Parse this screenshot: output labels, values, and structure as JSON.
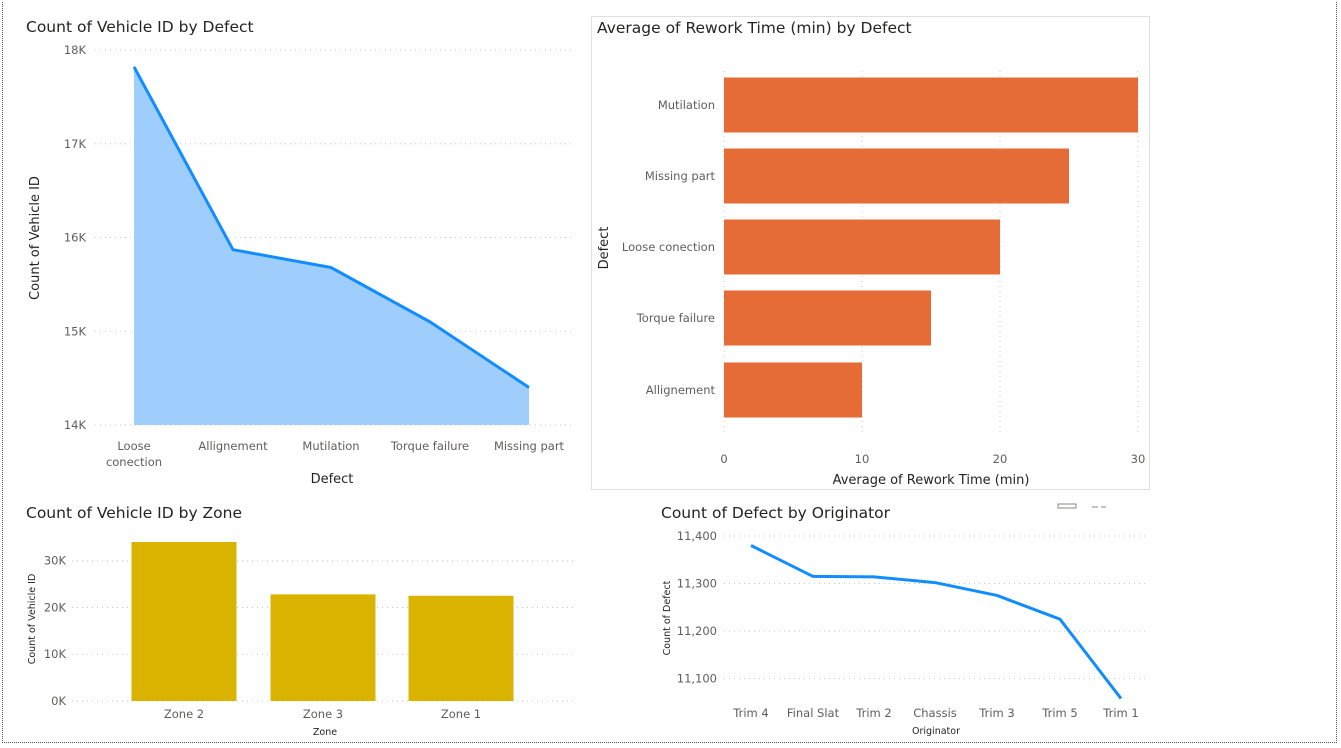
{
  "colors": {
    "line_blue": "#118DFF",
    "area_fill": "#9FCEFC",
    "bar_orange": "#E66C37",
    "bar_gold": "#D9B300"
  },
  "visuals": {
    "v1": {
      "title": "Count of Vehicle ID by Defect"
    },
    "v2": {
      "title": "Average of Rework Time (min) by Defect"
    },
    "v3": {
      "title": "Count of Vehicle ID by Zone"
    },
    "v4": {
      "title": "Count of Defect by Originator"
    }
  },
  "chart_data": [
    {
      "type": "area",
      "title": "Count of Vehicle ID by Defect",
      "xlabel": "Defect",
      "ylabel": "Count of Vehicle ID",
      "categories": [
        "Loose conection",
        "Allignement",
        "Mutilation",
        "Torque failure",
        "Missing part"
      ],
      "values": [
        17820,
        15870,
        15680,
        15100,
        14400
      ],
      "ylim": [
        14000,
        18000
      ],
      "yticks": [
        14000,
        15000,
        16000,
        17000,
        18000
      ],
      "ytick_labels": [
        "14K",
        "15K",
        "16K",
        "17K",
        "18K"
      ],
      "grid": true
    },
    {
      "type": "bar",
      "orientation": "horizontal",
      "title": "Average of Rework Time (min) by Defect",
      "xlabel": "Average of Rework Time (min)",
      "ylabel": "Defect",
      "categories": [
        "Mutilation",
        "Missing part",
        "Loose conection",
        "Torque failure",
        "Allignement"
      ],
      "values": [
        30,
        25,
        20,
        15,
        10
      ],
      "xlim": [
        0,
        30
      ],
      "xticks": [
        0,
        10,
        20,
        30
      ],
      "xtick_labels": [
        "0",
        "10",
        "20",
        "30"
      ],
      "grid": true
    },
    {
      "type": "bar",
      "title": "Count of Vehicle ID by Zone",
      "xlabel": "Zone",
      "ylabel": "Count of Vehicle ID",
      "categories": [
        "Zone 2",
        "Zone 3",
        "Zone 1"
      ],
      "values": [
        34000,
        22800,
        22500
      ],
      "ylim": [
        0,
        34000
      ],
      "yticks": [
        0,
        10000,
        20000,
        30000
      ],
      "ytick_labels": [
        "0K",
        "10K",
        "20K",
        "30K"
      ],
      "grid": true
    },
    {
      "type": "line",
      "title": "Count of Defect by Originator",
      "xlabel": "Originator",
      "ylabel": "Count of Defect",
      "categories": [
        "Trim 4",
        "Final Slat",
        "Trim 2",
        "Chassis",
        "Trim 3",
        "Trim 5",
        "Trim 1"
      ],
      "values": [
        11380,
        11315,
        11314,
        11302,
        11275,
        11225,
        11058
      ],
      "ylim": [
        11055,
        11400
      ],
      "yticks": [
        11100,
        11200,
        11300,
        11400
      ],
      "ytick_labels": [
        "11,100",
        "11,200",
        "11,300",
        "11,400"
      ],
      "grid": true
    }
  ]
}
